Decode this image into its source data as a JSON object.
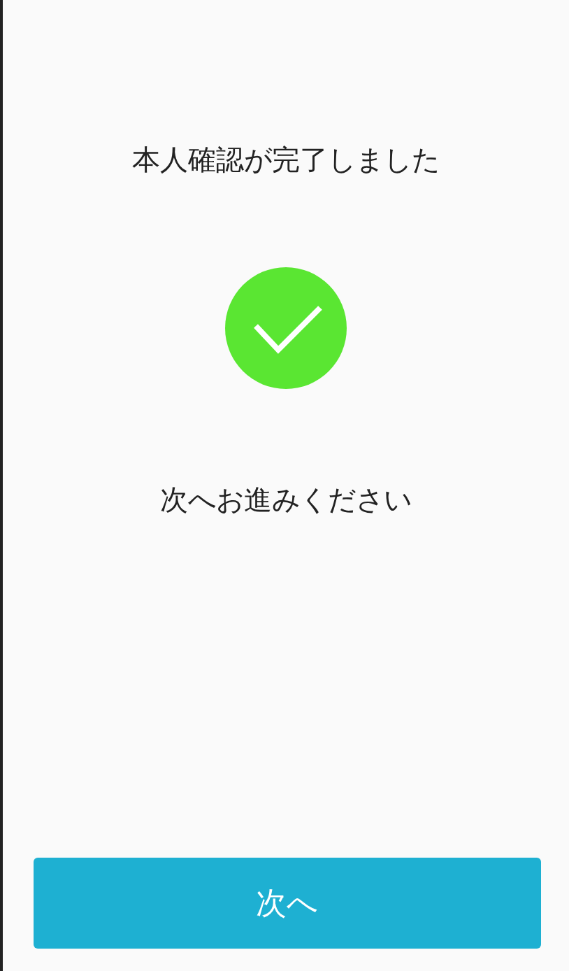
{
  "title": "本人確認が完了しました",
  "message": "次へお進みください",
  "button": {
    "label": "次へ"
  }
}
